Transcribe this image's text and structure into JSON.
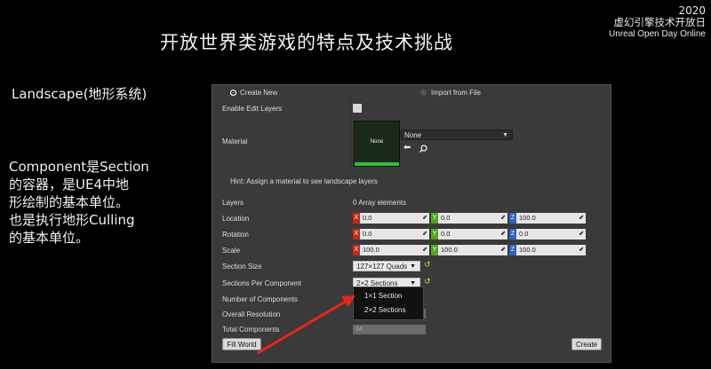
{
  "slide": {
    "title": "开放世界类游戏的特点及技术挑战",
    "brand": {
      "year": "2020",
      "event_cn": "虚幻引擎技术开放日",
      "event_en": "Unreal Open Day Online"
    },
    "landscape_label": "Landscape(地形系统)",
    "description_lines": [
      "Component是Section",
      "的容器，是UE4中地",
      "形绘制的基本单位。",
      "也是执行地形Culling",
      "的基本单位。"
    ]
  },
  "panel": {
    "mode": {
      "create_new": "Create New",
      "import_from_file": "Import from File",
      "selected": "create_new"
    },
    "enable_edit_layers": {
      "label": "Enable Edit Layers",
      "checked": false
    },
    "material": {
      "label": "Material",
      "thumbnail_text": "None",
      "value": "None"
    },
    "hint": "Hint: Assign a material to see landscape layers",
    "layers": {
      "label": "Layers",
      "value": "0 Array elements"
    },
    "location": {
      "label": "Location",
      "x": "0.0",
      "y": "0.0",
      "z": "100.0"
    },
    "rotation": {
      "label": "Rotation",
      "x": "0.0",
      "y": "0.0",
      "z": "0.0"
    },
    "scale": {
      "label": "Scale",
      "x": "100.0",
      "y": "100.0",
      "z": "100.0"
    },
    "section_size": {
      "label": "Section Size",
      "value": "127×127 Quads"
    },
    "sections_per_component": {
      "label": "Sections Per Component",
      "value": "2×2 Sections",
      "options": [
        "1×1 Section",
        "2×2 Sections"
      ]
    },
    "number_of_components": {
      "label": "Number of Components"
    },
    "overall_resolution": {
      "label": "Overall Resolution"
    },
    "total_components": {
      "label": "Total Components",
      "value": "64"
    },
    "fill_world": "Fill World",
    "create": "Create"
  },
  "colors": {
    "axis_x": "#c8281b",
    "axis_y": "#56a51b",
    "axis_z": "#2d63c3",
    "arrow": "#e8251a",
    "panel_bg": "#3a3a3a"
  }
}
